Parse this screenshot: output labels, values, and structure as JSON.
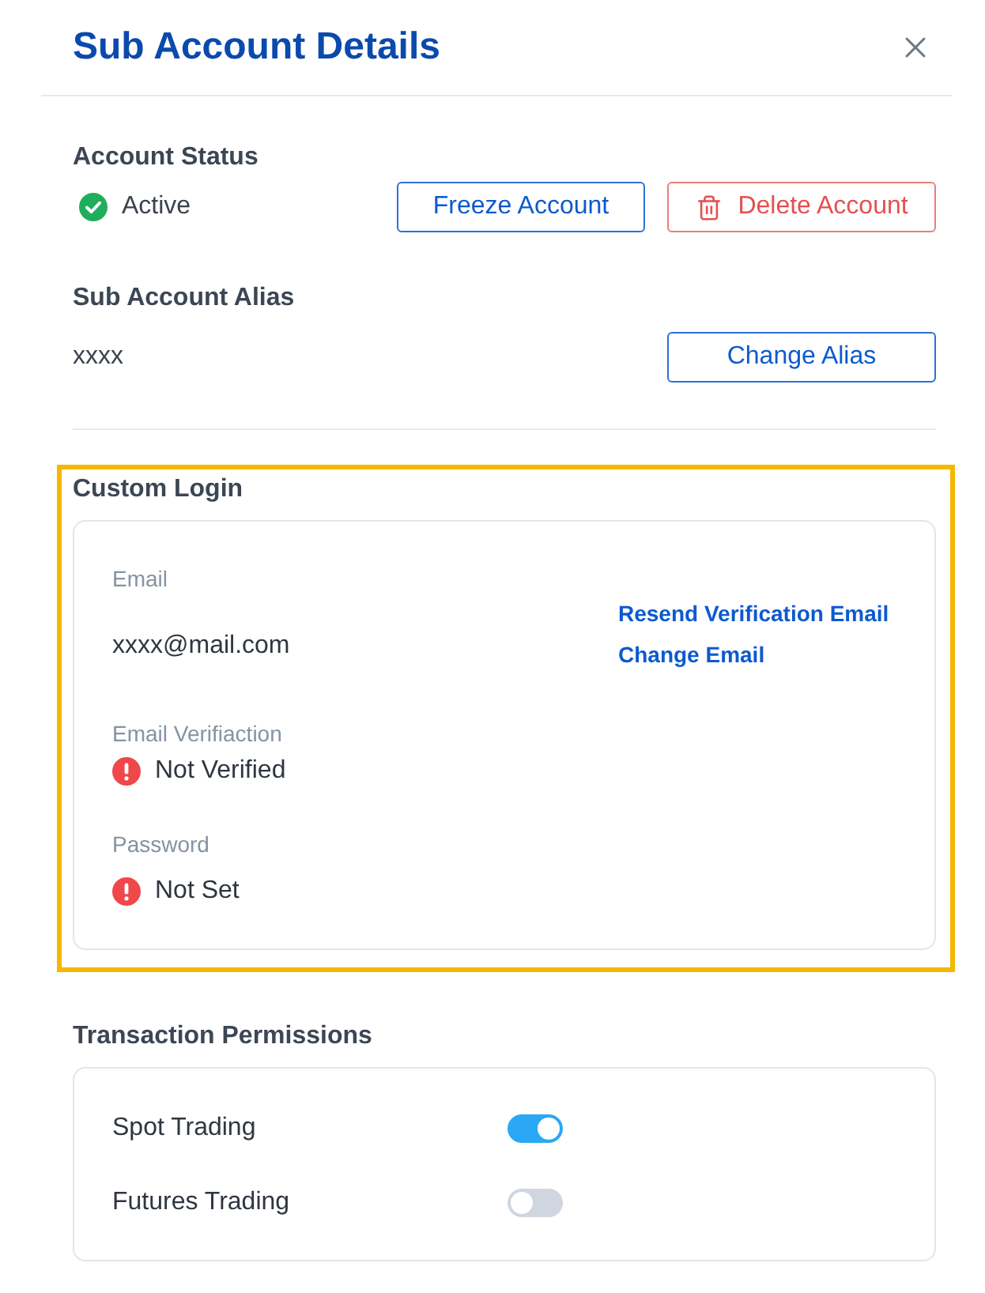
{
  "header": {
    "title": "Sub Account Details"
  },
  "account_status": {
    "label": "Account Status",
    "status": {
      "text": "Active",
      "kind": "ok"
    },
    "buttons": [
      {
        "label": "Freeze Account",
        "kind": "outline"
      },
      {
        "label": "Delete Account",
        "kind": "danger"
      }
    ]
  },
  "alias": {
    "label": "Sub Account Alias",
    "value": "xxxx",
    "button": "Change Alias"
  },
  "custom_login": {
    "highlighted": true,
    "title": "Custom Login",
    "email_label": "Email",
    "email": "xxxx@mail.com",
    "links": [
      "Resend Verification Email",
      "Change Email"
    ],
    "fields": [
      {
        "label": "Email Verifiaction",
        "value": "Not Verified",
        "kind": "error"
      },
      {
        "label": "Password",
        "value": "Not Set",
        "kind": "error"
      }
    ]
  },
  "transaction_permissions": {
    "title": "Transaction Permissions",
    "items": [
      {
        "label": "Spot Trading",
        "on": true
      },
      {
        "label": "Futures Trading",
        "on": false
      }
    ]
  }
}
